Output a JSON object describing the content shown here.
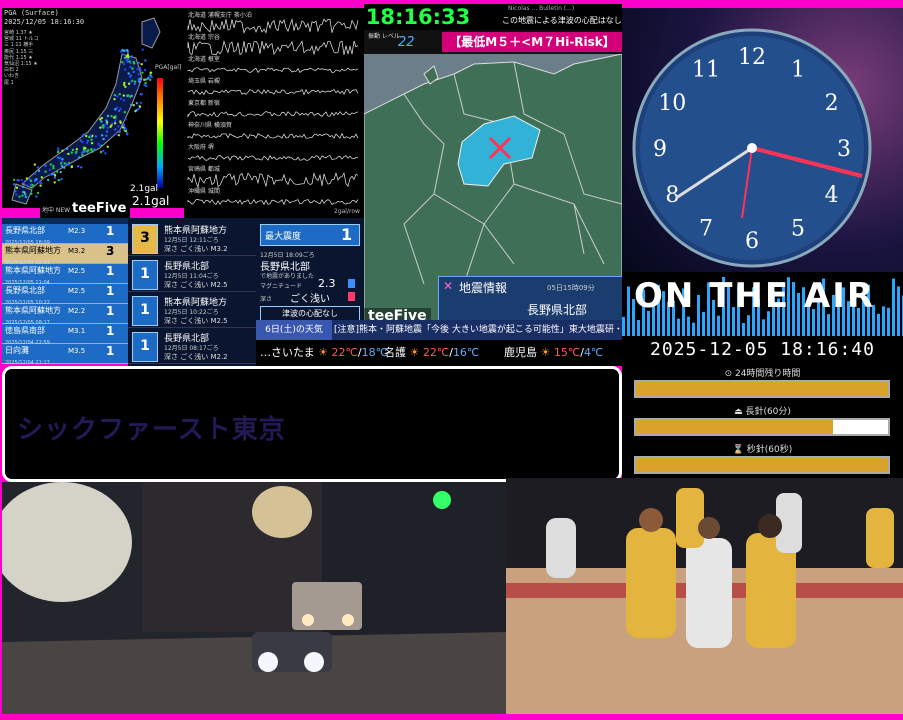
{
  "seismic": {
    "header_line1": "PGA (Surface)",
    "header_line2": "2025/12/05 18:16:30",
    "stations": [
      "宮崎 1.37 ★",
      "宮城 11 トルコ",
      "三 1.11 横手",
      "奥尻 1.15 三",
      "能代 1.15 ★",
      "気仙沼 1.15 ★",
      "白石 2",
      "いわき",
      "尾 1"
    ],
    "scale_label": "PGA[gal]",
    "peak_small": "2.1gal",
    "peak_large": "2.1gal",
    "brand": "teeFive",
    "new_label": "地中 NEW"
  },
  "waveforms": {
    "labels": [
      "北海道 浦幌支庁 茶小泊",
      "北海道 宗谷",
      "北海道 根室",
      "埼玉県 岩槻",
      "東京都 新宿",
      "神奈川県 横須賀",
      "大阪府 堺",
      "宮崎県 都城",
      "沖縄県 城間"
    ],
    "footer": "2gal/row"
  },
  "quake_list": [
    {
      "place": "長野県北部",
      "time": "2025/12/05 18:09",
      "mag": "M2.3",
      "shindo": "1",
      "highlight": false
    },
    {
      "place": "熊本県阿蘇地方",
      "time": "2025/12/05 12:11",
      "mag": "M3.2",
      "shindo": "3",
      "highlight": true
    },
    {
      "place": "熊本県阿蘇地方",
      "time": "2025/12/05 11:04",
      "mag": "M2.5",
      "shindo": "1",
      "highlight": false
    },
    {
      "place": "長野県北部",
      "time": "2025/12/05 10:22",
      "mag": "M2.5",
      "shindo": "1",
      "highlight": false
    },
    {
      "place": "熊本県阿蘇地方",
      "time": "2025/12/05 08:17",
      "mag": "M2.2",
      "shindo": "1",
      "highlight": false
    },
    {
      "place": "徳島県南部",
      "time": "2025/12/04 22:59",
      "mag": "M3.1",
      "shindo": "1",
      "highlight": false
    },
    {
      "place": "日向灘",
      "time": "2025/12/04 21:17",
      "mag": "M3.5",
      "shindo": "1",
      "highlight": false
    }
  ],
  "quake_detail": [
    {
      "badge": "3",
      "place": "熊本県阿蘇地方",
      "time": "12月5日 12:11ごろ",
      "info": "深さ ごく浅い M3.2",
      "yellow": true
    },
    {
      "badge": "1",
      "place": "長野県北部",
      "time": "12月5日 11:04ごろ",
      "info": "深さ ごく浅い M2.5",
      "yellow": false
    },
    {
      "badge": "1",
      "place": "熊本県阿蘇地方",
      "time": "12月5日 10:22ごろ",
      "info": "深さ ごく浅い M2.5",
      "yellow": false
    },
    {
      "badge": "1",
      "place": "長野県北部",
      "time": "12月5日 08:17ごろ",
      "info": "深さ ごく浅い M2.2",
      "yellow": false
    }
  ],
  "latest": {
    "max_shindo_label": "最大震度",
    "max_shindo": "1",
    "time": "12月5日 18:09ごろ",
    "place": "長野県北部",
    "sub": "で地震がありました",
    "mag_label": "マグニチュード",
    "mag": "2.3",
    "depth_label": "深さ",
    "depth": "ごく浅い",
    "tsunami": "津波の心配なし"
  },
  "top": {
    "clock": "18:16:33",
    "tsunami_head": "Nicolas ... Bulletin (...)",
    "tsunami_text": "この地震による津波の心配はなし",
    "level_label": "振動 レベル",
    "level_value": "22",
    "risk": "【最低M５＋<M７Hi-Risk】"
  },
  "map": {
    "brand": "teeFive",
    "info_title": "地震情報",
    "info_time": "05日15時09分",
    "info_place": "長野県北部"
  },
  "ticker": {
    "day": "6日(土)の天気",
    "news": "[注意]熊本・阿蘇地震「今後 大きい地震が起こる可能性」東大地震研・笠原教授"
  },
  "weather": [
    {
      "city": "…さいたま",
      "hi": "22℃",
      "lo": "18℃"
    },
    {
      "city": "名護",
      "hi": "22℃",
      "lo": "16℃"
    },
    {
      "city": "鹿児島",
      "hi": "15℃",
      "lo": "4℃"
    }
  ],
  "caption": {
    "text": "シックファースト東京"
  },
  "clockface": {
    "numbers": [
      "12",
      "1",
      "2",
      "3",
      "4",
      "5",
      "6",
      "7",
      "8",
      "9",
      "10",
      "11"
    ]
  },
  "onair": {
    "title": "ON THE AIR"
  },
  "datetime": "2025-12-05 18:16:40",
  "progress": [
    {
      "label": "⊙ 24時間残り時間",
      "fraction": 1.0
    },
    {
      "label": "⏏ 長針(60分)",
      "fraction": 0.78
    },
    {
      "label": "⌛ 秒針(60秒)",
      "fraction": 1.0
    }
  ],
  "colors": {
    "accent": "#ff00cc",
    "clock_green": "#22ff44",
    "risk": "#d4007a",
    "progress": "#d9a22a"
  }
}
